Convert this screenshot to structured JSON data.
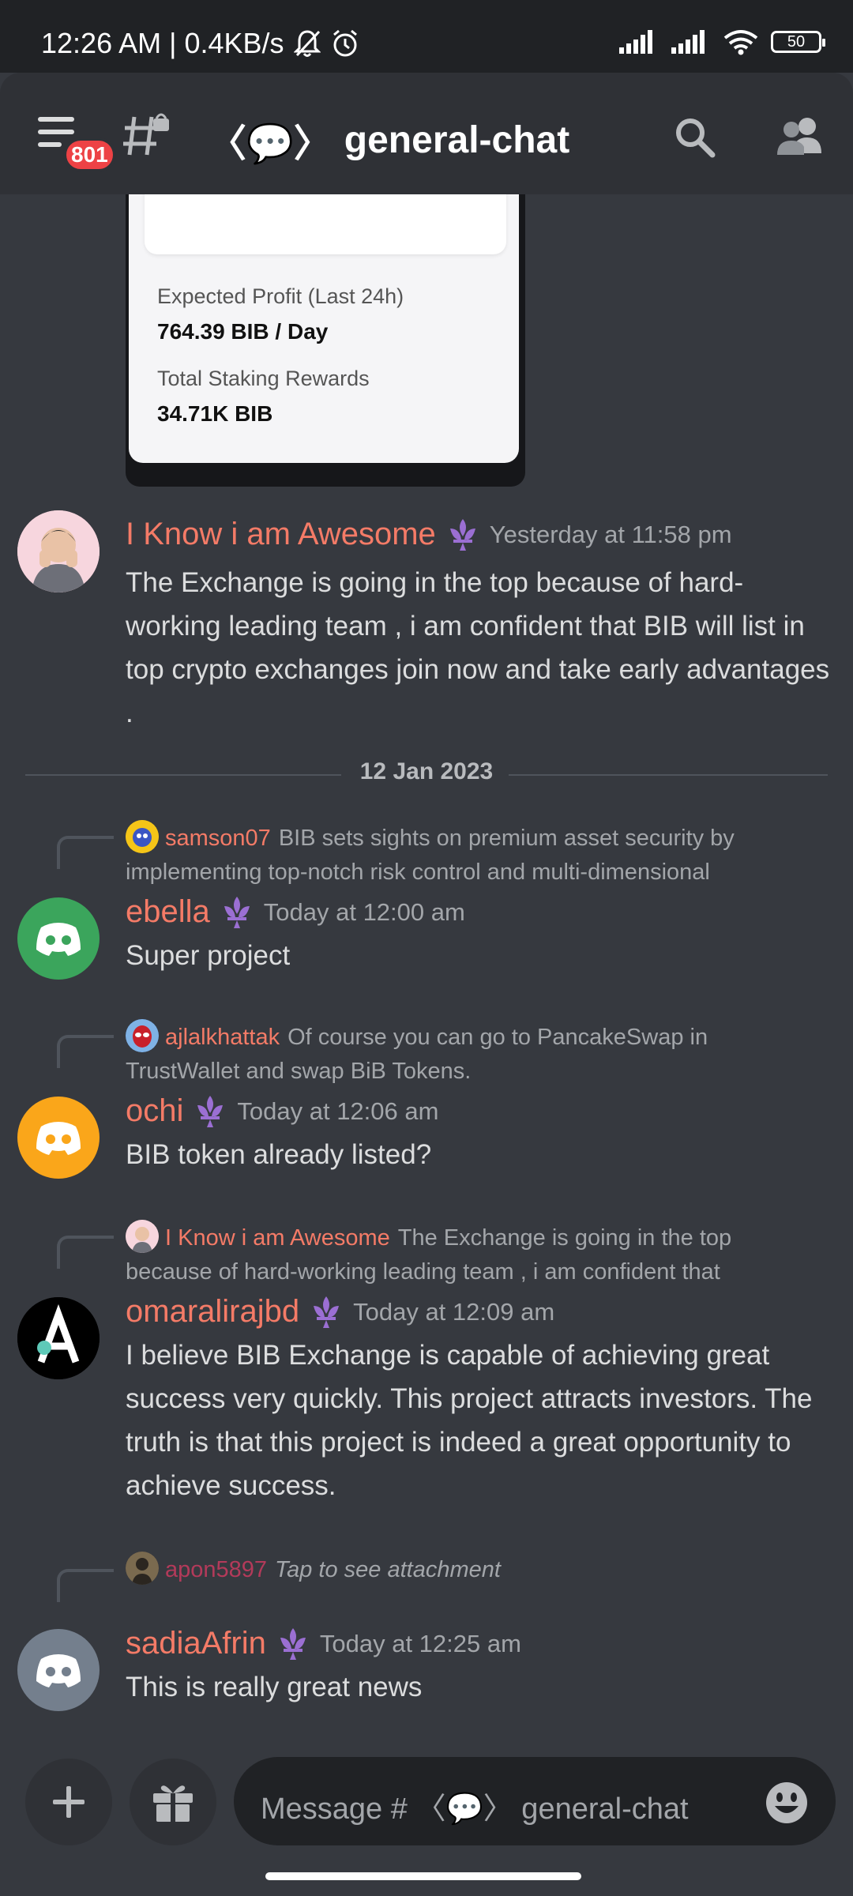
{
  "status_bar": {
    "time_and_speed": "12:26 AM | 0.4KB/s",
    "battery": "50"
  },
  "header": {
    "notification_badge": "801",
    "channel_deco_left": "〈💬〉",
    "channel_name": "general-chat"
  },
  "attachment": {
    "label1": "Expected Profit (Last 24h)",
    "value1": "764.39 BIB / Day",
    "label2": "Total Staking Rewards",
    "value2": "34.71K BIB"
  },
  "messages": [
    {
      "author": "I Know i am Awesome",
      "timestamp": "Yesterday at 11:58 pm",
      "body": "The Exchange is going in the top because of hard-working leading team , i am confident that BIB will list in top crypto exchanges join now and take early advantages ."
    },
    {
      "reply_author": "samson07",
      "reply_text": "BIB sets sights on premium asset security by implementing top-notch risk control and multi-dimensional",
      "author": "ebella",
      "timestamp": "Today at 12:00 am",
      "body": "Super project"
    },
    {
      "reply_author": "ajlalkhattak",
      "reply_text": "Of course you can go to PancakeSwap in TrustWallet and swap BiB Tokens.",
      "author": "ochi",
      "timestamp": "Today at 12:06 am",
      "body": "BIB token already listed?"
    },
    {
      "reply_author": "I Know i am Awesome",
      "reply_text": "The Exchange is going in the top because of hard-working leading team , i am confident that",
      "author": "omaralirajbd",
      "timestamp": "Today at 12:09 am",
      "body": "I believe BIB Exchange is capable of achieving great success very quickly. This project attracts investors. The truth is that this project is indeed a great opportunity to achieve success."
    },
    {
      "reply_author": "apon5897",
      "reply_text": "Tap to see attachment",
      "author": "sadiaAfrin",
      "timestamp": "Today at 12:25 am",
      "body": "This is really great news"
    }
  ],
  "date_divider": "12 Jan 2023",
  "composer": {
    "placeholder": "Message # 〈💬〉 general-chat"
  },
  "colors": {
    "background": "#36393f",
    "header": "#2f3136",
    "username": "#f47b67",
    "badge": "#ed4245",
    "avatar_green": "#3ba55c",
    "avatar_orange": "#faa61a",
    "avatar_grey": "#747f8d"
  }
}
